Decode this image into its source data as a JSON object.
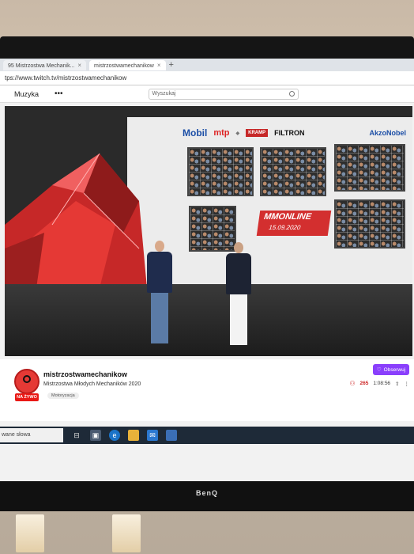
{
  "browser": {
    "tabs": [
      {
        "label": "95 Mistrzostwa Mechanik..."
      },
      {
        "label": "mistrzostwamechanikow"
      }
    ],
    "url": "tps://www.twitch.tv/mistrzostwamechanikow"
  },
  "twitch_nav": {
    "music": "Muzyka",
    "more": "•••",
    "search_placeholder": "Wyszukaj"
  },
  "stage": {
    "sponsors": [
      "Mobil",
      "mtp",
      "KRAMP",
      "FILTRON",
      "AkzoNobel"
    ],
    "event_logo": "MMONLINE",
    "event_date": "15.09.2020"
  },
  "channel": {
    "live_badge": "NA ŻYWO",
    "name": "mistrzostwamechanikow",
    "title": "Mistrzostwa Młodych Mechaników 2020",
    "category": "Motoryzacja",
    "follow_label": "Obserwuj",
    "viewers": "265",
    "uptime": "1:08:56"
  },
  "taskbar": {
    "search_text": "wane słowa"
  },
  "monitor": {
    "brand": "BenQ"
  }
}
